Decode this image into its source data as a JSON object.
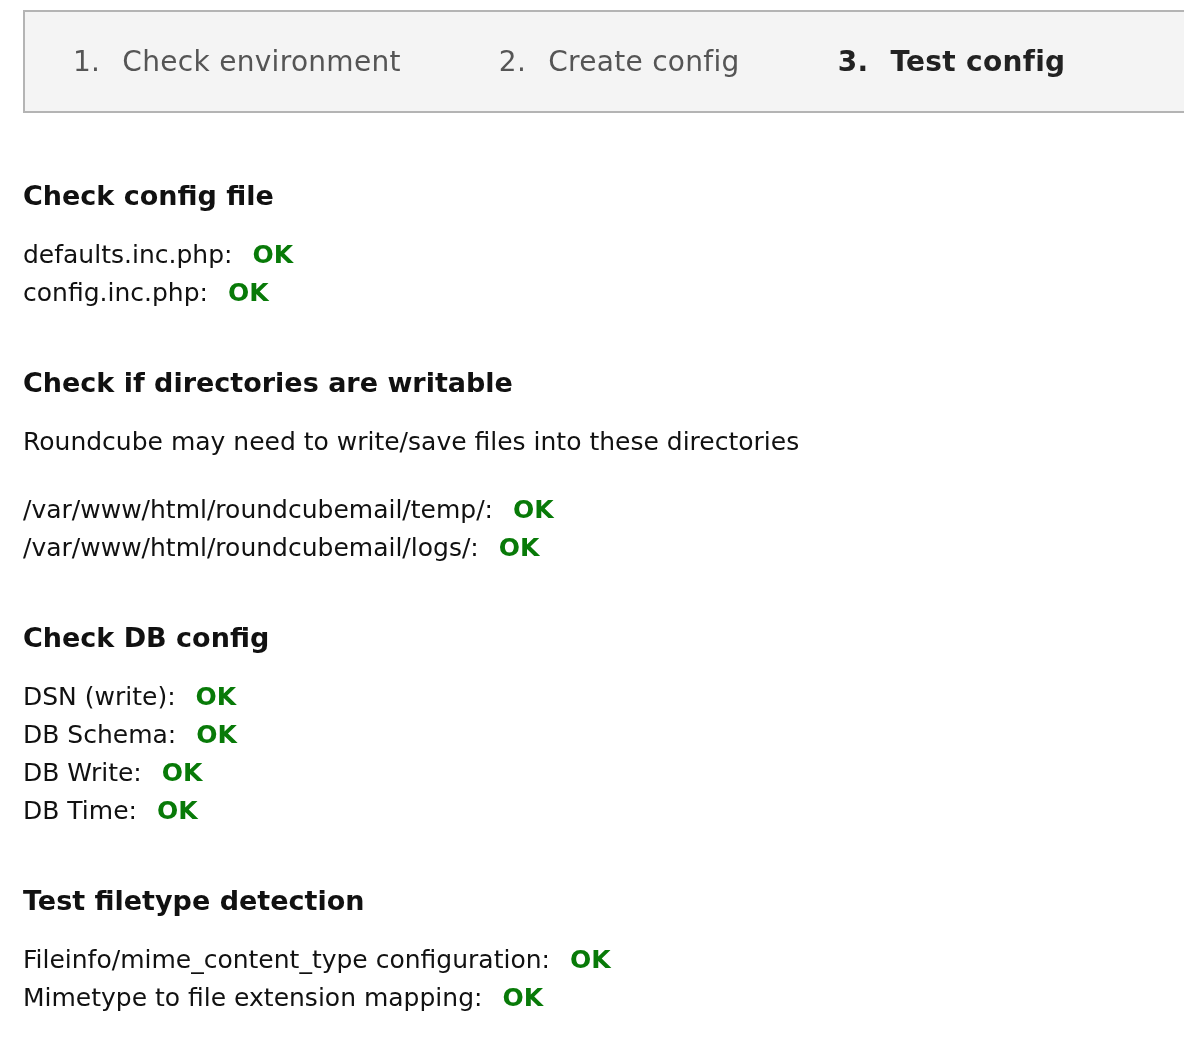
{
  "steps": [
    {
      "number": "1.",
      "label": "Check environment",
      "selected": false
    },
    {
      "number": "2.",
      "label": "Create config",
      "selected": false
    },
    {
      "number": "3.",
      "label": "Test config",
      "selected": true
    }
  ],
  "sections": [
    {
      "title": "Check config file",
      "items": [
        {
          "label": "defaults.inc.php:",
          "status": "OK"
        },
        {
          "label": "config.inc.php:",
          "status": "OK"
        }
      ]
    },
    {
      "title": "Check if directories are writable",
      "note": "Roundcube may need to write/save files into these directories",
      "items": [
        {
          "label": "/var/www/html/roundcubemail/temp/:",
          "status": "OK"
        },
        {
          "label": "/var/www/html/roundcubemail/logs/:",
          "status": "OK"
        }
      ]
    },
    {
      "title": "Check DB config",
      "items": [
        {
          "label": "DSN (write):",
          "status": "OK"
        },
        {
          "label": "DB Schema:",
          "status": "OK"
        },
        {
          "label": "DB Write:",
          "status": "OK"
        },
        {
          "label": "DB Time:",
          "status": "OK"
        }
      ]
    },
    {
      "title": "Test filetype detection",
      "items": [
        {
          "label": "Fileinfo/mime_content_type configuration:",
          "status": "OK"
        },
        {
          "label": "Mimetype to file extension mapping:",
          "status": "OK"
        }
      ]
    }
  ]
}
